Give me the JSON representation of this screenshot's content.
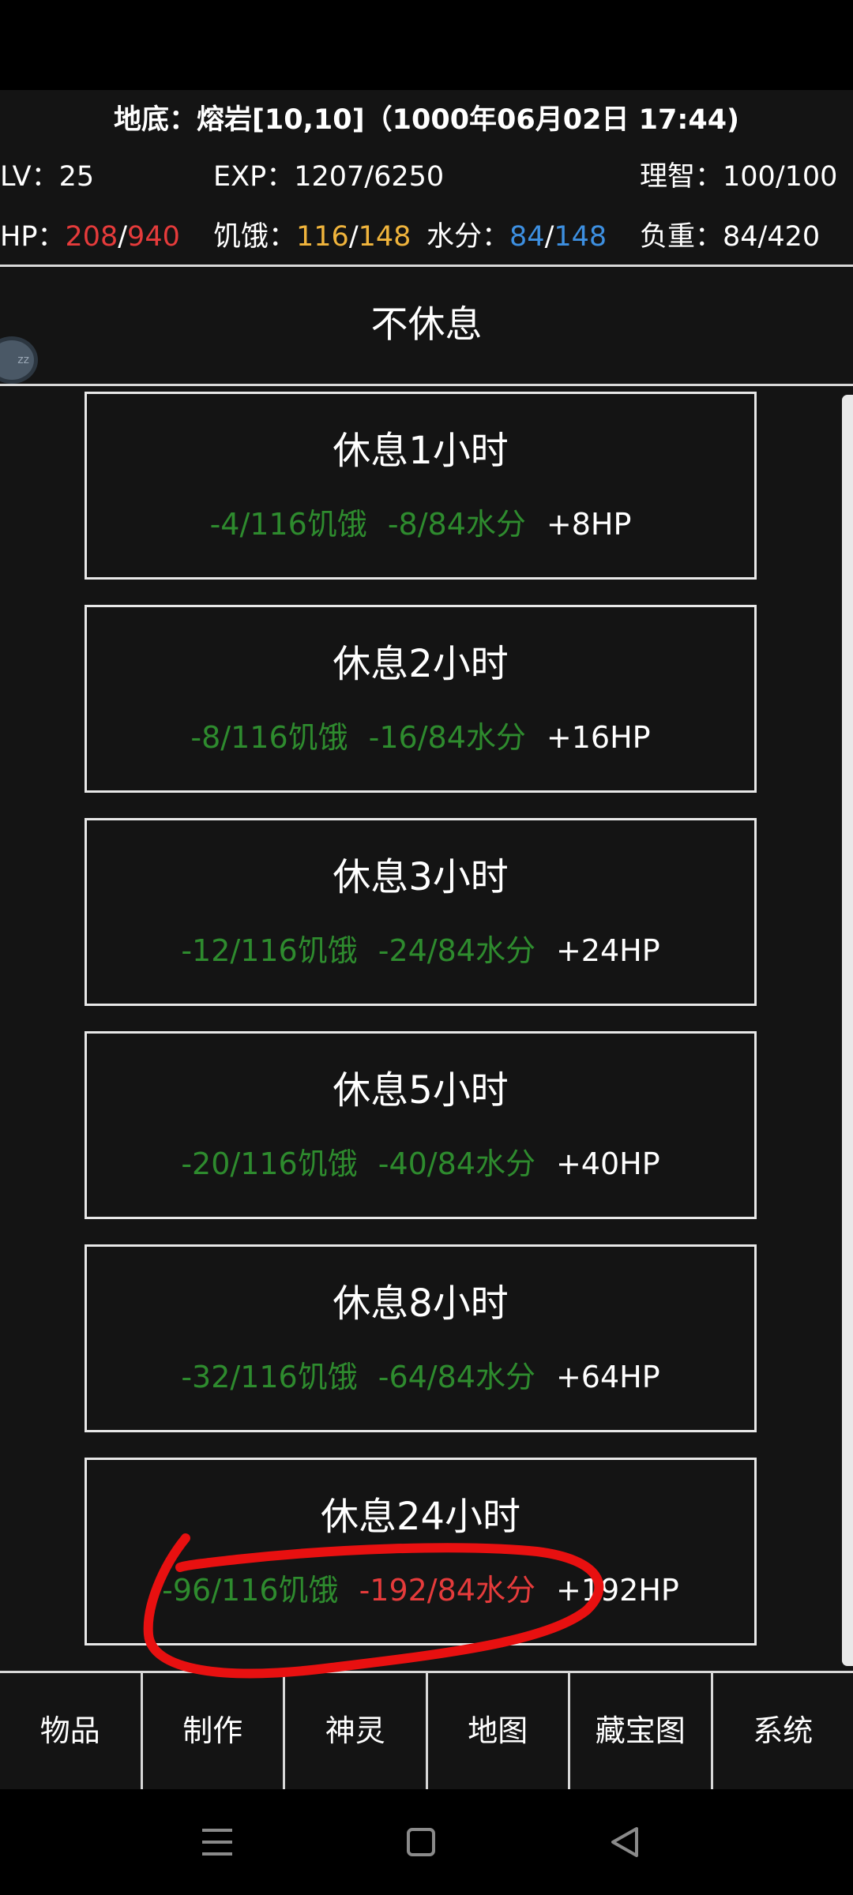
{
  "header": {
    "location": "地底：熔岩[10,10]（1000年06月02日 17:44)"
  },
  "stats": {
    "lv_label": "LV：",
    "lv_value": "25",
    "exp_label": "EXP：",
    "exp_value": "1207/6250",
    "sanity_label": "理智：",
    "sanity_value": "100/100",
    "hp_label": "HP：",
    "hp_current": "208",
    "hp_sep": "/",
    "hp_max": "940",
    "hunger_label": "饥饿：",
    "hunger_current": "116",
    "hunger_sep": "/",
    "hunger_max": "148",
    "water_label": "水分：",
    "water_current": "84",
    "water_sep": "/",
    "water_max": "148",
    "load_label": "负重：",
    "load_value": "84/420"
  },
  "no_rest_label": "不休息",
  "float_bubble_text": "zz",
  "rest_options": [
    {
      "title": "休息1小时",
      "hunger": "-4/116饥饿",
      "water": "-8/84水分",
      "hp": "+8HP"
    },
    {
      "title": "休息2小时",
      "hunger": "-8/116饥饿",
      "water": "-16/84水分",
      "hp": "+16HP"
    },
    {
      "title": "休息3小时",
      "hunger": "-12/116饥饿",
      "water": "-24/84水分",
      "hp": "+24HP"
    },
    {
      "title": "休息5小时",
      "hunger": "-20/116饥饿",
      "water": "-40/84水分",
      "hp": "+40HP"
    },
    {
      "title": "休息8小时",
      "hunger": "-32/116饥饿",
      "water": "-64/84水分",
      "hp": "+64HP"
    },
    {
      "title": "休息24小时",
      "hunger": "-96/116饥饿",
      "water": "-192/84水分",
      "hp": "+192HP"
    }
  ],
  "bottom_nav": [
    "物品",
    "制作",
    "神灵",
    "地图",
    "藏宝图",
    "系统"
  ],
  "colors": {
    "background": "#141414",
    "hp_red": "#e53b3b",
    "hunger_yellow": "#f0b43c",
    "water_blue": "#3d8fe0",
    "effect_green": "#2e8b2e",
    "annotation_red": "#e81010"
  },
  "icons": {
    "system_nav": [
      "menu-icon",
      "home-square-icon",
      "back-triangle-icon"
    ]
  }
}
